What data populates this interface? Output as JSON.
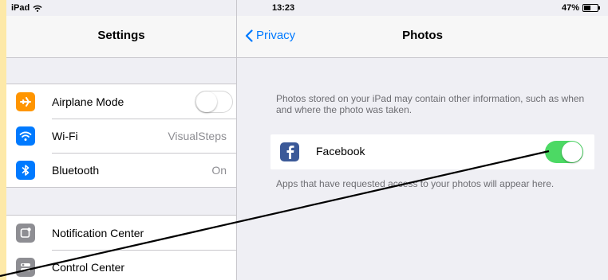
{
  "status_bar": {
    "device": "iPad",
    "time": "13:23",
    "battery": "47%",
    "battery_level": 0.47
  },
  "settings_panel": {
    "title": "Settings",
    "group1": [
      {
        "label": "Airplane Mode",
        "value": "",
        "icon": "airplane-icon",
        "color": "#ff9500",
        "toggle": "off"
      },
      {
        "label": "Wi-Fi",
        "value": "VisualSteps",
        "icon": "wifi-icon",
        "color": "#007aff"
      },
      {
        "label": "Bluetooth",
        "value": "On",
        "icon": "bluetooth-icon",
        "color": "#007aff"
      }
    ],
    "group2": [
      {
        "label": "Notification Center",
        "icon": "notification-center-icon",
        "color": "#8e8e93"
      },
      {
        "label": "Control Center",
        "icon": "control-center-icon",
        "color": "#8e8e93"
      }
    ]
  },
  "photos_panel": {
    "back_label": "Privacy",
    "title": "Photos",
    "description": "Photos stored on your iPad may contain other information, such as when and where the photo was taken.",
    "apps": [
      {
        "label": "Facebook",
        "icon": "facebook-icon",
        "color": "#3b5998",
        "toggle": "on"
      }
    ],
    "footer": "Apps that have requested access to your photos will appear here."
  },
  "accent_colors": {
    "ios_blue": "#007aff",
    "toggle_on": "#4cd964"
  }
}
